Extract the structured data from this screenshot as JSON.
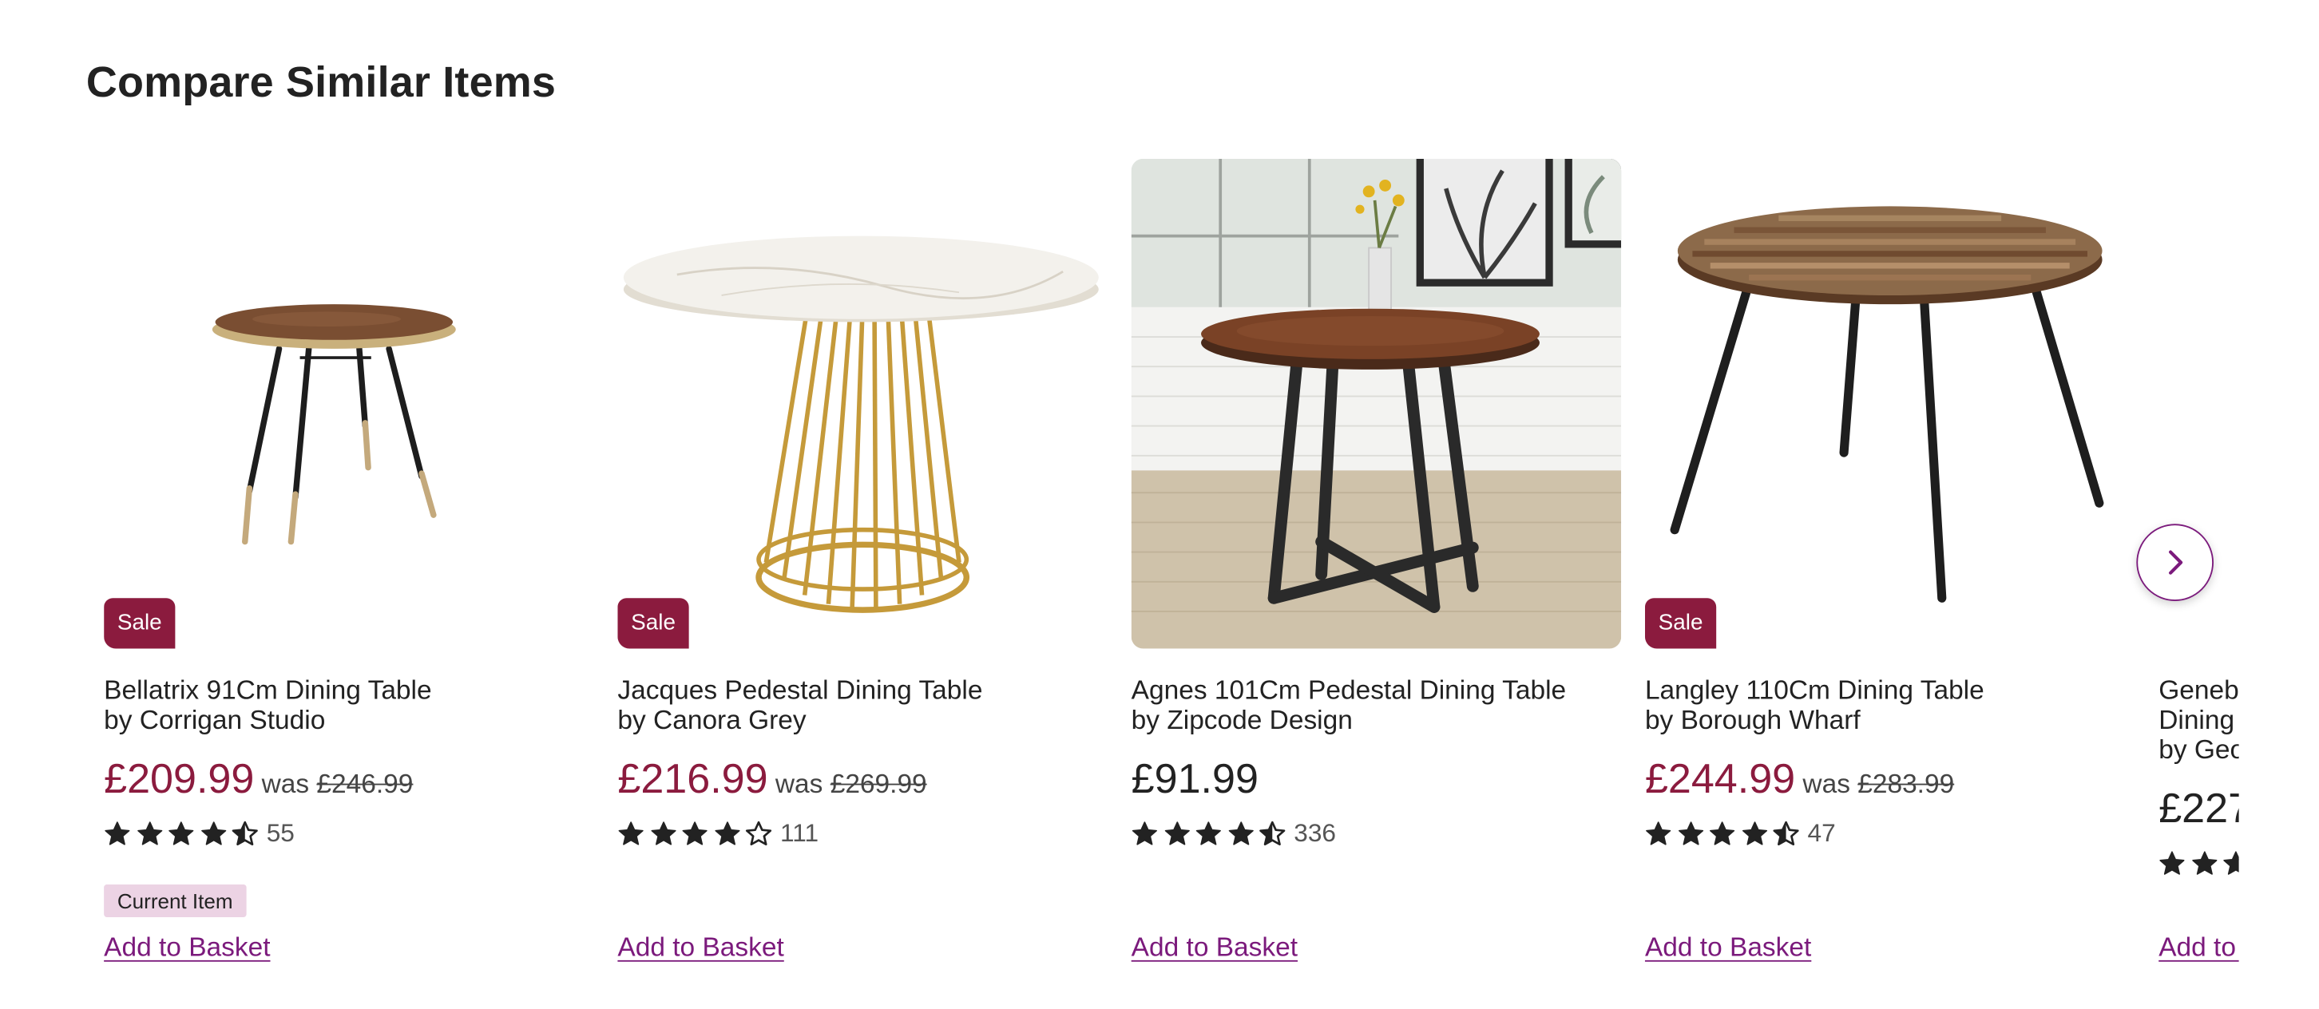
{
  "section": {
    "title": "Compare Similar Items"
  },
  "colors": {
    "sale_red": "#8b1b3e",
    "link_purple": "#7b1a7c",
    "current_badge_bg": "#ecd3e4"
  },
  "carousel": {
    "next_icon": "chevron-right-icon"
  },
  "products": [
    {
      "name": "Bellatrix 91Cm Dining Table",
      "brand": "by Corrigan Studio",
      "price": "£209.99",
      "was_label": "was",
      "was_price": "£246.99",
      "sale_badge": "Sale",
      "rating": 4.5,
      "reviews": "55",
      "current_item": "Current Item",
      "add_to_basket": "Add to Basket"
    },
    {
      "name": "Jacques Pedestal Dining Table",
      "brand": "by Canora Grey",
      "price": "£216.99",
      "was_label": "was",
      "was_price": "£269.99",
      "sale_badge": "Sale",
      "rating": 4,
      "reviews": "111",
      "add_to_basket": "Add to Basket"
    },
    {
      "name": "Agnes 101Cm Pedestal Dining Table",
      "brand": "by Zipcode Design",
      "price": "£91.99",
      "rating": 4.5,
      "reviews": "336",
      "add_to_basket": "Add to Basket"
    },
    {
      "name": "Langley 110Cm Dining Table",
      "brand": "by Borough Wharf",
      "price": "£244.99",
      "was_label": "was",
      "was_price": "£283.99",
      "sale_badge": "Sale",
      "rating": 4.5,
      "reviews": "47",
      "add_to_basket": "Add to Basket"
    },
    {
      "name_line1": "Geneb",
      "name_line2": "Dining",
      "brand": "by Geo",
      "price": "£227",
      "add_to_basket": "Add to Basket"
    }
  ]
}
